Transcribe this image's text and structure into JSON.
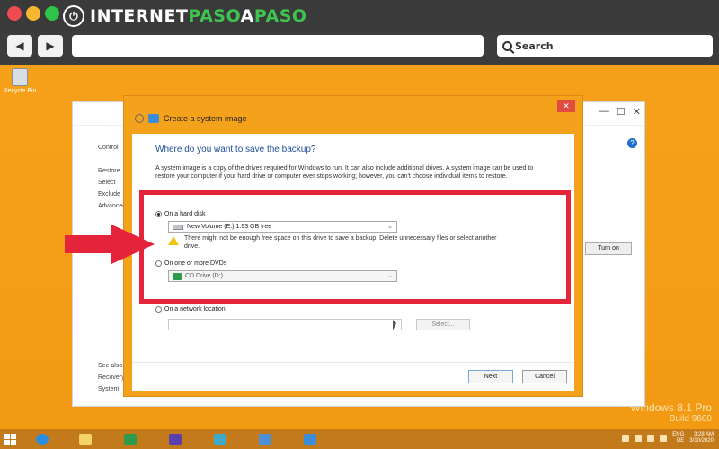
{
  "browser": {
    "logo": {
      "part1": "INTERNET",
      "part2": "PASO",
      "part3": "A",
      "part4": "PASO"
    },
    "search": {
      "placeholder": "Search"
    },
    "nav": {
      "back": "◀",
      "forward": "▶"
    }
  },
  "desktop": {
    "recycle_label": "Recycle Bin",
    "watermark": {
      "line1": "Windows 8.1 Pro",
      "line2": "Build 9600"
    }
  },
  "back_window": {
    "left_links": [
      "Control",
      "Restore",
      "Select",
      "Exclude",
      "Advanced"
    ],
    "left_bottom": [
      "See also",
      "Recovery",
      "System"
    ],
    "turn_on_label": "Turn on",
    "help": "?"
  },
  "dialog": {
    "title": "Create a system image",
    "close": "✕",
    "heading": "Where do you want to save the backup?",
    "description": "A system image is a copy of the drives required for Windows to run. It can also include additional drives. A system image can be used to restore your computer if your hard drive or computer ever stops working; however, you can't choose individual items to restore.",
    "options": {
      "hard_disk": {
        "label": "On a hard disk",
        "selected": true,
        "value": "New Volume (E:)  1.93 GB free"
      },
      "warning": "There might not be enough free space on this drive to save a backup. Delete unnecessary files or select another drive.",
      "dvd": {
        "label": "On one or more DVDs",
        "selected": false,
        "value": "CD Drive (D:)"
      },
      "network": {
        "label": "On a network location",
        "selected": false,
        "select_button": "Select..."
      }
    },
    "buttons": {
      "next": "Next",
      "cancel": "Cancel"
    }
  },
  "taskbar": {
    "tray": {
      "lang": "ENG",
      "region": "DE",
      "time": "3:28 AM",
      "date": "3/10/2020"
    }
  },
  "colors": {
    "desktop": "#f4a21c",
    "annotation_red": "#e4243a",
    "link_blue": "#1f4e9a",
    "logo_green": "#3fc24f"
  }
}
